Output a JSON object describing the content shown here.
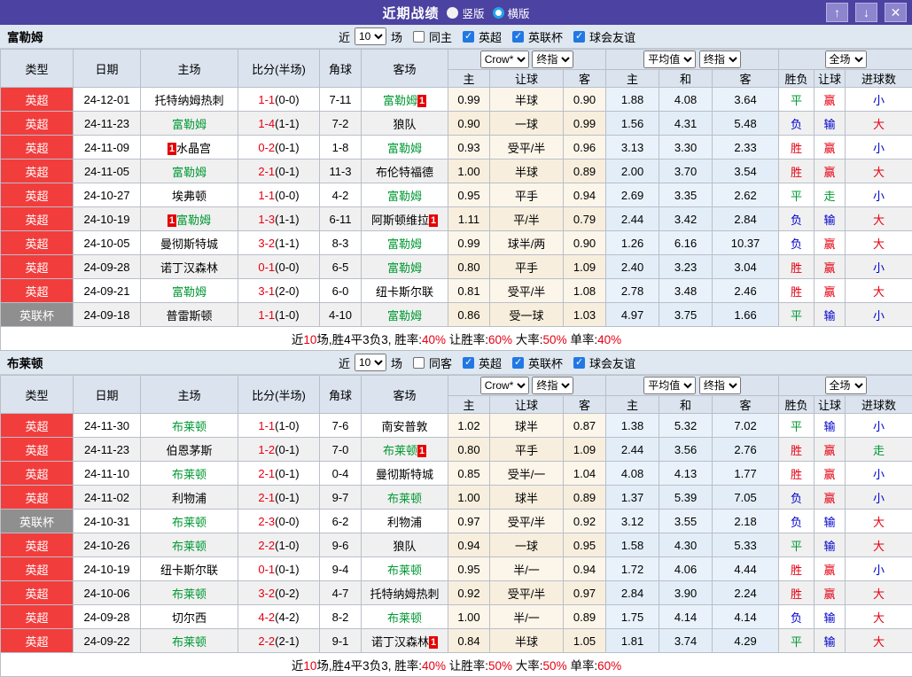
{
  "titlebar": {
    "title": "近期战绩",
    "radios": [
      {
        "label": "竖版",
        "variant": "solid",
        "selected": true
      },
      {
        "label": "横版",
        "variant": "ring",
        "selected": false
      }
    ],
    "buttons": {
      "up": "↑",
      "down": "↓",
      "close": "✕"
    }
  },
  "filter": {
    "near": "近",
    "games_select": "10",
    "games_suffix": "场",
    "leagues": [
      "英超",
      "英联杯",
      "球会友谊"
    ]
  },
  "header": {
    "left_cols": [
      "类型",
      "日期",
      "主场",
      "比分(半场)",
      "角球",
      "客场"
    ],
    "odds_select": "Crow*",
    "final_select": "终指",
    "avg_select": "平均值",
    "scope_select": "全场",
    "odds_cols": [
      "主",
      "让球",
      "客"
    ],
    "avg_cols": [
      "主",
      "和",
      "客"
    ],
    "result_cols": [
      "胜负",
      "让球",
      "进球数"
    ]
  },
  "sections": [
    {
      "team": "富勒姆",
      "same_label": "同主",
      "rows": [
        {
          "type": "英超",
          "type_style": "epl",
          "date": "24-12-01",
          "home": "托特纳姆热刺",
          "home_green": false,
          "home_badge": "",
          "score": "1-1",
          "half": "(0-0)",
          "corner": "7-11",
          "away": "富勒姆",
          "away_green": true,
          "away_badge": "1",
          "odds": [
            "0.99",
            "半球",
            "0.90"
          ],
          "avg": [
            "1.88",
            "4.08",
            "3.64"
          ],
          "res": [
            [
              "平",
              "g"
            ],
            [
              "赢",
              "r"
            ],
            [
              "小",
              "b"
            ]
          ]
        },
        {
          "type": "英超",
          "type_style": "epl",
          "date": "24-11-23",
          "home": "富勒姆",
          "home_green": true,
          "home_badge": "",
          "score": "1-4",
          "half": "(1-1)",
          "corner": "7-2",
          "away": "狼队",
          "away_green": false,
          "away_badge": "",
          "odds": [
            "0.90",
            "一球",
            "0.99"
          ],
          "avg": [
            "1.56",
            "4.31",
            "5.48"
          ],
          "res": [
            [
              "负",
              "b"
            ],
            [
              "输",
              "b"
            ],
            [
              "大",
              "r"
            ]
          ]
        },
        {
          "type": "英超",
          "type_style": "epl",
          "date": "24-11-09",
          "home": "水晶宫",
          "home_green": false,
          "home_badge": "1",
          "score": "0-2",
          "half": "(0-1)",
          "corner": "1-8",
          "away": "富勒姆",
          "away_green": true,
          "away_badge": "",
          "odds": [
            "0.93",
            "受平/半",
            "0.96"
          ],
          "avg": [
            "3.13",
            "3.30",
            "2.33"
          ],
          "res": [
            [
              "胜",
              "r"
            ],
            [
              "赢",
              "r"
            ],
            [
              "小",
              "b"
            ]
          ]
        },
        {
          "type": "英超",
          "type_style": "epl",
          "date": "24-11-05",
          "home": "富勒姆",
          "home_green": true,
          "home_badge": "",
          "score": "2-1",
          "half": "(0-1)",
          "corner": "11-3",
          "away": "布伦特福德",
          "away_green": false,
          "away_badge": "",
          "odds": [
            "1.00",
            "半球",
            "0.89"
          ],
          "avg": [
            "2.00",
            "3.70",
            "3.54"
          ],
          "res": [
            [
              "胜",
              "r"
            ],
            [
              "赢",
              "r"
            ],
            [
              "大",
              "r"
            ]
          ]
        },
        {
          "type": "英超",
          "type_style": "epl",
          "date": "24-10-27",
          "home": "埃弗顿",
          "home_green": false,
          "home_badge": "",
          "score": "1-1",
          "half": "(0-0)",
          "corner": "4-2",
          "away": "富勒姆",
          "away_green": true,
          "away_badge": "",
          "odds": [
            "0.95",
            "平手",
            "0.94"
          ],
          "avg": [
            "2.69",
            "3.35",
            "2.62"
          ],
          "res": [
            [
              "平",
              "g"
            ],
            [
              "走",
              "g"
            ],
            [
              "小",
              "b"
            ]
          ]
        },
        {
          "type": "英超",
          "type_style": "epl",
          "date": "24-10-19",
          "home": "富勒姆",
          "home_green": true,
          "home_badge": "1",
          "score": "1-3",
          "half": "(1-1)",
          "corner": "6-11",
          "away": "阿斯顿维拉",
          "away_green": false,
          "away_badge": "1",
          "odds": [
            "1.11",
            "平/半",
            "0.79"
          ],
          "avg": [
            "2.44",
            "3.42",
            "2.84"
          ],
          "res": [
            [
              "负",
              "b"
            ],
            [
              "输",
              "b"
            ],
            [
              "大",
              "r"
            ]
          ]
        },
        {
          "type": "英超",
          "type_style": "epl",
          "date": "24-10-05",
          "home": "曼彻斯特城",
          "home_green": false,
          "home_badge": "",
          "score": "3-2",
          "half": "(1-1)",
          "corner": "8-3",
          "away": "富勒姆",
          "away_green": true,
          "away_badge": "",
          "odds": [
            "0.99",
            "球半/两",
            "0.90"
          ],
          "avg": [
            "1.26",
            "6.16",
            "10.37"
          ],
          "res": [
            [
              "负",
              "b"
            ],
            [
              "赢",
              "r"
            ],
            [
              "大",
              "r"
            ]
          ]
        },
        {
          "type": "英超",
          "type_style": "epl",
          "date": "24-09-28",
          "home": "诺丁汉森林",
          "home_green": false,
          "home_badge": "",
          "score": "0-1",
          "half": "(0-0)",
          "corner": "6-5",
          "away": "富勒姆",
          "away_green": true,
          "away_badge": "",
          "odds": [
            "0.80",
            "平手",
            "1.09"
          ],
          "avg": [
            "2.40",
            "3.23",
            "3.04"
          ],
          "res": [
            [
              "胜",
              "r"
            ],
            [
              "赢",
              "r"
            ],
            [
              "小",
              "b"
            ]
          ]
        },
        {
          "type": "英超",
          "type_style": "epl",
          "date": "24-09-21",
          "home": "富勒姆",
          "home_green": true,
          "home_badge": "",
          "score": "3-1",
          "half": "(2-0)",
          "corner": "6-0",
          "away": "纽卡斯尔联",
          "away_green": false,
          "away_badge": "",
          "odds": [
            "0.81",
            "受平/半",
            "1.08"
          ],
          "avg": [
            "2.78",
            "3.48",
            "2.46"
          ],
          "res": [
            [
              "胜",
              "r"
            ],
            [
              "赢",
              "r"
            ],
            [
              "大",
              "r"
            ]
          ]
        },
        {
          "type": "英联杯",
          "type_style": "cup",
          "date": "24-09-18",
          "home": "普雷斯顿",
          "home_green": false,
          "home_badge": "",
          "score": "1-1",
          "half": "(1-0)",
          "corner": "4-10",
          "away": "富勒姆",
          "away_green": true,
          "away_badge": "",
          "odds": [
            "0.86",
            "受一球",
            "1.03"
          ],
          "avg": [
            "4.97",
            "3.75",
            "1.66"
          ],
          "res": [
            [
              "平",
              "g"
            ],
            [
              "输",
              "b"
            ],
            [
              "小",
              "b"
            ]
          ]
        }
      ],
      "summary_parts": [
        [
          "近",
          "k"
        ],
        [
          "10",
          "r"
        ],
        [
          "场,胜4平3负3, 胜率:",
          "k"
        ],
        [
          "40%",
          "r"
        ],
        [
          " 让胜率:",
          "k"
        ],
        [
          "60%",
          "r"
        ],
        [
          " 大率:",
          "k"
        ],
        [
          "50%",
          "r"
        ],
        [
          " 单率:",
          "k"
        ],
        [
          "40%",
          "r"
        ]
      ]
    },
    {
      "team": "布莱顿",
      "same_label": "同客",
      "rows": [
        {
          "type": "英超",
          "type_style": "epl",
          "date": "24-11-30",
          "home": "布莱顿",
          "home_green": true,
          "home_badge": "",
          "score": "1-1",
          "half": "(1-0)",
          "corner": "7-6",
          "away": "南安普敦",
          "away_green": false,
          "away_badge": "",
          "odds": [
            "1.02",
            "球半",
            "0.87"
          ],
          "avg": [
            "1.38",
            "5.32",
            "7.02"
          ],
          "res": [
            [
              "平",
              "g"
            ],
            [
              "输",
              "b"
            ],
            [
              "小",
              "b"
            ]
          ]
        },
        {
          "type": "英超",
          "type_style": "epl",
          "date": "24-11-23",
          "home": "伯恩茅斯",
          "home_green": false,
          "home_badge": "",
          "score": "1-2",
          "half": "(0-1)",
          "corner": "7-0",
          "away": "布莱顿",
          "away_green": true,
          "away_badge": "1",
          "odds": [
            "0.80",
            "平手",
            "1.09"
          ],
          "avg": [
            "2.44",
            "3.56",
            "2.76"
          ],
          "res": [
            [
              "胜",
              "r"
            ],
            [
              "赢",
              "r"
            ],
            [
              "走",
              "g"
            ]
          ]
        },
        {
          "type": "英超",
          "type_style": "epl",
          "date": "24-11-10",
          "home": "布莱顿",
          "home_green": true,
          "home_badge": "",
          "score": "2-1",
          "half": "(0-1)",
          "corner": "0-4",
          "away": "曼彻斯特城",
          "away_green": false,
          "away_badge": "",
          "odds": [
            "0.85",
            "受半/一",
            "1.04"
          ],
          "avg": [
            "4.08",
            "4.13",
            "1.77"
          ],
          "res": [
            [
              "胜",
              "r"
            ],
            [
              "赢",
              "r"
            ],
            [
              "小",
              "b"
            ]
          ]
        },
        {
          "type": "英超",
          "type_style": "epl",
          "date": "24-11-02",
          "home": "利物浦",
          "home_green": false,
          "home_badge": "",
          "score": "2-1",
          "half": "(0-1)",
          "corner": "9-7",
          "away": "布莱顿",
          "away_green": true,
          "away_badge": "",
          "odds": [
            "1.00",
            "球半",
            "0.89"
          ],
          "avg": [
            "1.37",
            "5.39",
            "7.05"
          ],
          "res": [
            [
              "负",
              "b"
            ],
            [
              "赢",
              "r"
            ],
            [
              "小",
              "b"
            ]
          ]
        },
        {
          "type": "英联杯",
          "type_style": "cup",
          "date": "24-10-31",
          "home": "布莱顿",
          "home_green": true,
          "home_badge": "",
          "score": "2-3",
          "half": "(0-0)",
          "corner": "6-2",
          "away": "利物浦",
          "away_green": false,
          "away_badge": "",
          "odds": [
            "0.97",
            "受平/半",
            "0.92"
          ],
          "avg": [
            "3.12",
            "3.55",
            "2.18"
          ],
          "res": [
            [
              "负",
              "b"
            ],
            [
              "输",
              "b"
            ],
            [
              "大",
              "r"
            ]
          ]
        },
        {
          "type": "英超",
          "type_style": "epl",
          "date": "24-10-26",
          "home": "布莱顿",
          "home_green": true,
          "home_badge": "",
          "score": "2-2",
          "half": "(1-0)",
          "corner": "9-6",
          "away": "狼队",
          "away_green": false,
          "away_badge": "",
          "odds": [
            "0.94",
            "一球",
            "0.95"
          ],
          "avg": [
            "1.58",
            "4.30",
            "5.33"
          ],
          "res": [
            [
              "平",
              "g"
            ],
            [
              "输",
              "b"
            ],
            [
              "大",
              "r"
            ]
          ]
        },
        {
          "type": "英超",
          "type_style": "epl",
          "date": "24-10-19",
          "home": "纽卡斯尔联",
          "home_green": false,
          "home_badge": "",
          "score": "0-1",
          "half": "(0-1)",
          "corner": "9-4",
          "away": "布莱顿",
          "away_green": true,
          "away_badge": "",
          "odds": [
            "0.95",
            "半/一",
            "0.94"
          ],
          "avg": [
            "1.72",
            "4.06",
            "4.44"
          ],
          "res": [
            [
              "胜",
              "r"
            ],
            [
              "赢",
              "r"
            ],
            [
              "小",
              "b"
            ]
          ]
        },
        {
          "type": "英超",
          "type_style": "epl",
          "date": "24-10-06",
          "home": "布莱顿",
          "home_green": true,
          "home_badge": "",
          "score": "3-2",
          "half": "(0-2)",
          "corner": "4-7",
          "away": "托特纳姆热刺",
          "away_green": false,
          "away_badge": "",
          "odds": [
            "0.92",
            "受平/半",
            "0.97"
          ],
          "avg": [
            "2.84",
            "3.90",
            "2.24"
          ],
          "res": [
            [
              "胜",
              "r"
            ],
            [
              "赢",
              "r"
            ],
            [
              "大",
              "r"
            ]
          ]
        },
        {
          "type": "英超",
          "type_style": "epl",
          "date": "24-09-28",
          "home": "切尔西",
          "home_green": false,
          "home_badge": "",
          "score": "4-2",
          "half": "(4-2)",
          "corner": "8-2",
          "away": "布莱顿",
          "away_green": true,
          "away_badge": "",
          "odds": [
            "1.00",
            "半/一",
            "0.89"
          ],
          "avg": [
            "1.75",
            "4.14",
            "4.14"
          ],
          "res": [
            [
              "负",
              "b"
            ],
            [
              "输",
              "b"
            ],
            [
              "大",
              "r"
            ]
          ]
        },
        {
          "type": "英超",
          "type_style": "epl",
          "date": "24-09-22",
          "home": "布莱顿",
          "home_green": true,
          "home_badge": "",
          "score": "2-2",
          "half": "(2-1)",
          "corner": "9-1",
          "away": "诺丁汉森林",
          "away_green": false,
          "away_badge": "1",
          "odds": [
            "0.84",
            "半球",
            "1.05"
          ],
          "avg": [
            "1.81",
            "3.74",
            "4.29"
          ],
          "res": [
            [
              "平",
              "g"
            ],
            [
              "输",
              "b"
            ],
            [
              "大",
              "r"
            ]
          ]
        }
      ],
      "summary_parts": [
        [
          "近",
          "k"
        ],
        [
          "10",
          "r"
        ],
        [
          "场,胜4平3负3, 胜率:",
          "k"
        ],
        [
          "40%",
          "r"
        ],
        [
          " 让胜率:",
          "k"
        ],
        [
          "50%",
          "r"
        ],
        [
          " 大率:",
          "k"
        ],
        [
          "50%",
          "r"
        ],
        [
          " 单率:",
          "k"
        ],
        [
          "60%",
          "r"
        ]
      ]
    }
  ]
}
